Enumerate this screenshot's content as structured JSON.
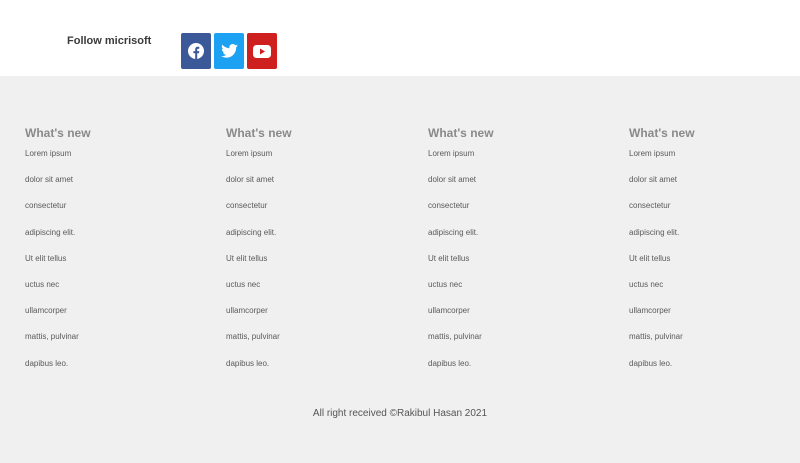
{
  "follow": {
    "label": "Follow micrisoft",
    "social": [
      {
        "name": "facebook",
        "icon": "facebook-icon",
        "color": "#3b5998"
      },
      {
        "name": "twitter",
        "icon": "twitter-icon",
        "color": "#1da1f2"
      },
      {
        "name": "youtube",
        "icon": "youtube-icon",
        "color": "#cd201f"
      }
    ]
  },
  "footer": {
    "columns": [
      {
        "title": "What's new",
        "links": [
          "Lorem ipsum",
          "dolor sit amet",
          "consectetur",
          "adipiscing elit.",
          "Ut elit tellus",
          "uctus nec",
          "ullamcorper",
          "mattis, pulvinar",
          "dapibus leo."
        ]
      },
      {
        "title": "What's new",
        "links": [
          "Lorem ipsum",
          "dolor sit amet",
          "consectetur",
          "adipiscing elit.",
          "Ut elit tellus",
          "uctus nec",
          "ullamcorper",
          "mattis, pulvinar",
          "dapibus leo."
        ]
      },
      {
        "title": "What's new",
        "links": [
          "Lorem ipsum",
          "dolor sit amet",
          "consectetur",
          "adipiscing elit.",
          "Ut elit tellus",
          "uctus nec",
          "ullamcorper",
          "mattis, pulvinar",
          "dapibus leo."
        ]
      },
      {
        "title": "What's new",
        "links": [
          "Lorem ipsum",
          "dolor sit amet",
          "consectetur",
          "adipiscing elit.",
          "Ut elit tellus",
          "uctus nec",
          "ullamcorper",
          "mattis, pulvinar",
          "dapibus leo."
        ]
      }
    ],
    "copyright": "All right received ©Rakibul Hasan 2021"
  }
}
